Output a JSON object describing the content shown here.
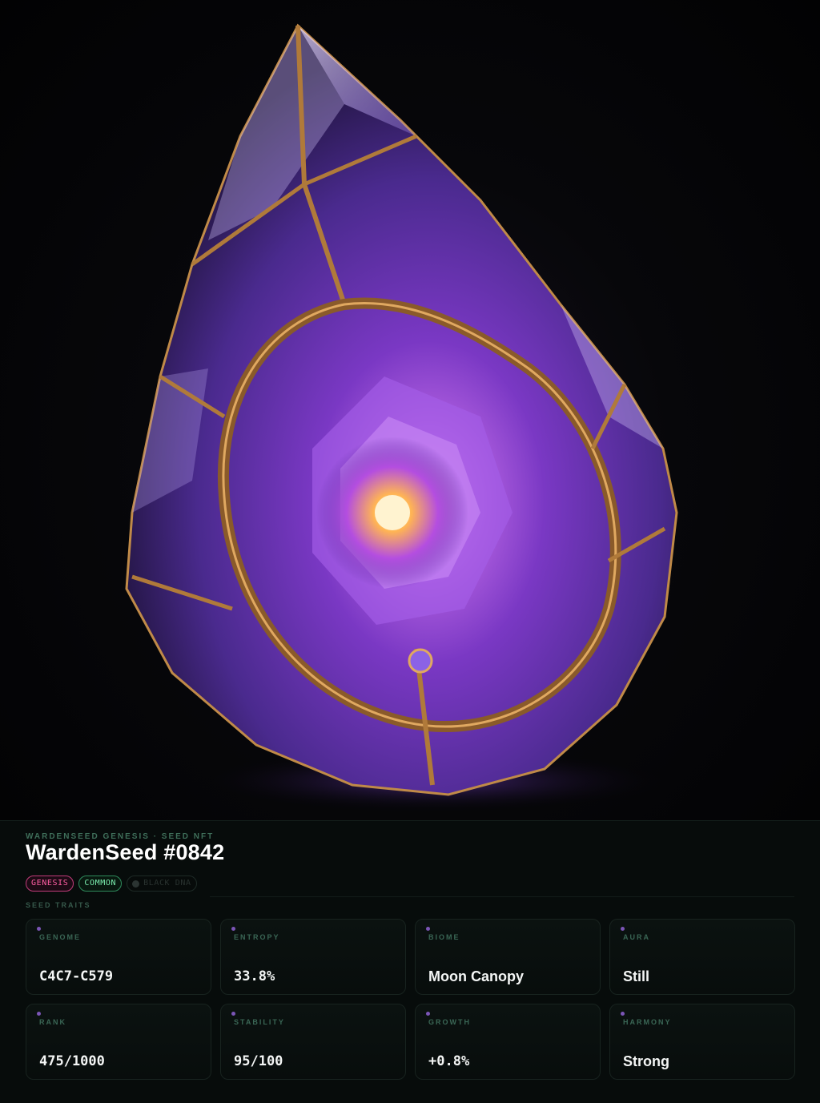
{
  "hero": {
    "image_subject": "crystal-seed-gem"
  },
  "header": {
    "eyebrow": "WARDENSEED GENESIS · SEED NFT",
    "title": "WardenSeed #0842"
  },
  "badges": [
    {
      "label": "GENESIS",
      "color": "#ff5fa4"
    },
    {
      "label": "COMMON",
      "color": "#7cf0b0"
    },
    {
      "label": "BLACK DNA",
      "color": "#2a3330"
    }
  ],
  "traits_label": "SEED TRAITS",
  "traits": [
    {
      "label": "GENOME",
      "value": "C4C7-C579"
    },
    {
      "label": "ENTROPY",
      "value": "33.8%"
    },
    {
      "label": "BIOME",
      "value": "Moon Canopy"
    },
    {
      "label": "AURA",
      "value": "Still"
    },
    {
      "label": "RANK",
      "value": "475/1000"
    },
    {
      "label": "STABILITY",
      "value": "95/100"
    },
    {
      "label": "GROWTH",
      "value": "+0.8%"
    },
    {
      "label": "HARMONY",
      "value": "Strong"
    }
  ],
  "colors": {
    "accent_purple": "#7b55b6",
    "trait_label": "#3a6655",
    "background": "#050908"
  }
}
